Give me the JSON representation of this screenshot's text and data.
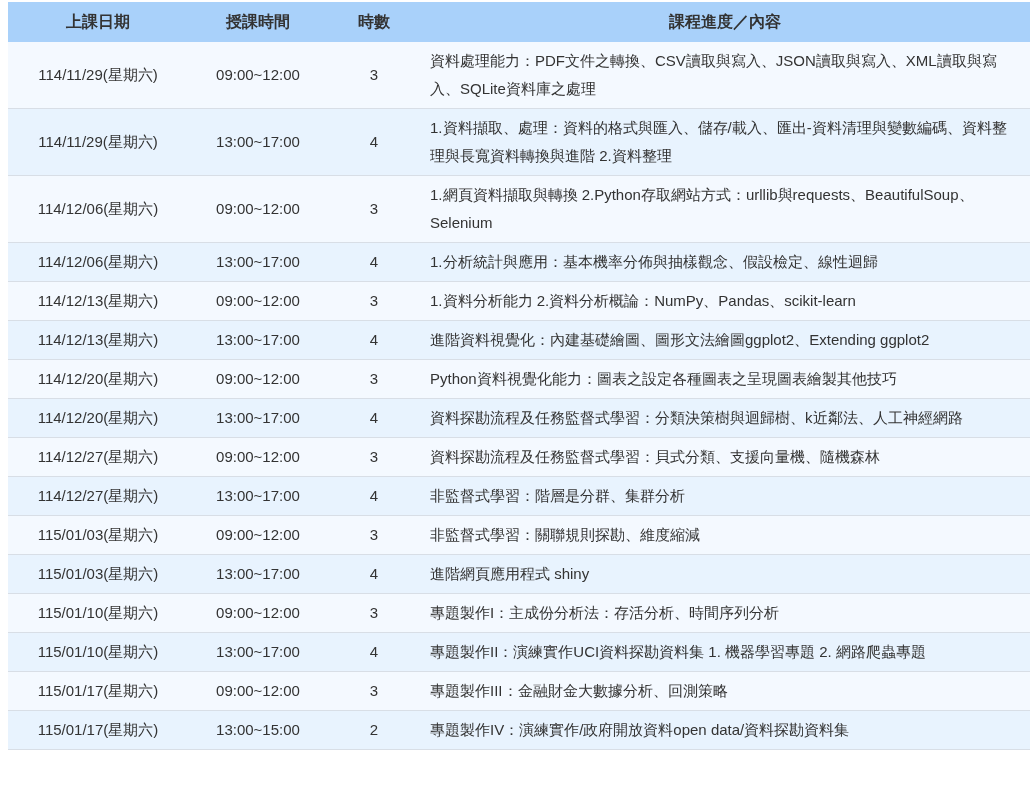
{
  "table": {
    "columns": [
      "上課日期",
      "授課時間",
      "時數",
      "課程進度／內容"
    ],
    "rows": [
      [
        "114/11/29(星期六)",
        "09:00~12:00",
        "3",
        "資料處理能力：PDF文件之轉換、CSV讀取與寫入、JSON讀取與寫入、XML讀取與寫入、SQLite資料庫之處理"
      ],
      [
        "114/11/29(星期六)",
        "13:00~17:00",
        "4",
        "1.資料擷取、處理：資料的格式與匯入、儲存/載入、匯出-資料清理與變數編碼、資料整理與長寬資料轉換與進階 2.資料整理"
      ],
      [
        "114/12/06(星期六)",
        "09:00~12:00",
        "3",
        "1.網頁資料擷取與轉換 2.Python存取網站方式：urllib與requests、BeautifulSoup、Selenium"
      ],
      [
        "114/12/06(星期六)",
        "13:00~17:00",
        "4",
        "1.分析統計與應用：基本機率分佈與抽樣觀念、假設檢定、線性迴歸"
      ],
      [
        "114/12/13(星期六)",
        "09:00~12:00",
        "3",
        "1.資料分析能力 2.資料分析概論：NumPy、Pandas、scikit-learn"
      ],
      [
        "114/12/13(星期六)",
        "13:00~17:00",
        "4",
        "進階資料視覺化：內建基礎繪圖、圖形文法繪圖ggplot2、Extending ggplot2"
      ],
      [
        "114/12/20(星期六)",
        "09:00~12:00",
        "3",
        "Python資料視覺化能力：圖表之設定各種圖表之呈現圖表繪製其他技巧"
      ],
      [
        "114/12/20(星期六)",
        "13:00~17:00",
        "4",
        "資料探勘流程及任務監督式學習：分類決策樹與迴歸樹、k近鄰法、人工神經網路"
      ],
      [
        "114/12/27(星期六)",
        "09:00~12:00",
        "3",
        "資料探勘流程及任務監督式學習：貝式分類、支援向量機、隨機森林"
      ],
      [
        "114/12/27(星期六)",
        "13:00~17:00",
        "4",
        "非監督式學習：階層是分群、集群分析"
      ],
      [
        "115/01/03(星期六)",
        "09:00~12:00",
        "3",
        "非監督式學習：關聯規則探勘、維度縮減"
      ],
      [
        "115/01/03(星期六)",
        "13:00~17:00",
        "4",
        "進階網頁應用程式 shiny"
      ],
      [
        "115/01/10(星期六)",
        "09:00~12:00",
        "3",
        "專題製作I：主成份分析法：存活分析、時間序列分析"
      ],
      [
        "115/01/10(星期六)",
        "13:00~17:00",
        "4",
        "專題製作II：演練實作UCI資料探勘資料集 1. 機器學習專題 2. 網路爬蟲專題"
      ],
      [
        "115/01/17(星期六)",
        "09:00~12:00",
        "3",
        "專題製作III：金融財金大數據分析、回測策略"
      ],
      [
        "115/01/17(星期六)",
        "13:00~15:00",
        "2",
        "專題製作IV：演練實作/政府開放資料open data/資料探勘資料集"
      ]
    ]
  }
}
